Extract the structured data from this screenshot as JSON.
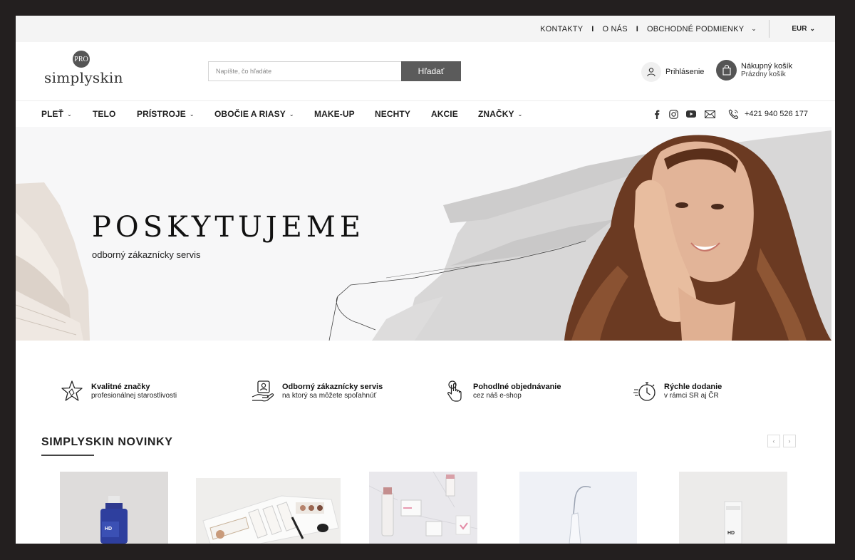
{
  "topbar": {
    "links": [
      "KONTAKTY",
      "O NÁS",
      "OBCHODNÉ PODMIENKY"
    ],
    "currency": "EUR"
  },
  "header": {
    "logo_badge": "PRO",
    "logo_text": "simplyskin",
    "search_placeholder": "Napíšte, čo hľadáte",
    "search_button": "Hľadať",
    "login_label": "Prihlásenie",
    "cart_title": "Nákupný košík",
    "cart_status": "Prázdny košík"
  },
  "nav": {
    "items": [
      "PLEŤ",
      "TELO",
      "PRÍSTROJE",
      "OBOČIE A RIASY",
      "MAKE-UP",
      "NECHTY",
      "AKCIE",
      "ZNAČKY"
    ],
    "social_icons": [
      "facebook-icon",
      "instagram-icon",
      "youtube-icon",
      "mail-icon"
    ],
    "phone": "+421 940 526 177"
  },
  "hero": {
    "title": "POSKYTUJEME",
    "subtitle": "odborný zákaznícky servis"
  },
  "features": [
    {
      "title": "Kvalitné značky",
      "desc": "profesionálnej starostlivosti",
      "icon": "star-icon"
    },
    {
      "title": "Odborný zákaznícky servis",
      "desc": "na ktorý sa môžete spoľahnúť",
      "icon": "support-hand-icon"
    },
    {
      "title": "Pohodlné objednávanie",
      "desc": "cez náš e-shop",
      "icon": "tap-hand-icon"
    },
    {
      "title": "Rýchle dodanie",
      "desc": "v rámci SR aj ČR",
      "icon": "stopwatch-icon"
    }
  ],
  "section": {
    "title": "SIMPLYSKIN NOVINKY",
    "prev": "‹",
    "next": "›"
  },
  "products": {
    "labels": [
      "HD",
      "HD"
    ]
  },
  "colors": {
    "topbar_bg": "#f4f4f4",
    "button_bg": "#5b5b5b",
    "frame_bg": "#231f1f",
    "serum_blue": "#2e3f9e"
  }
}
